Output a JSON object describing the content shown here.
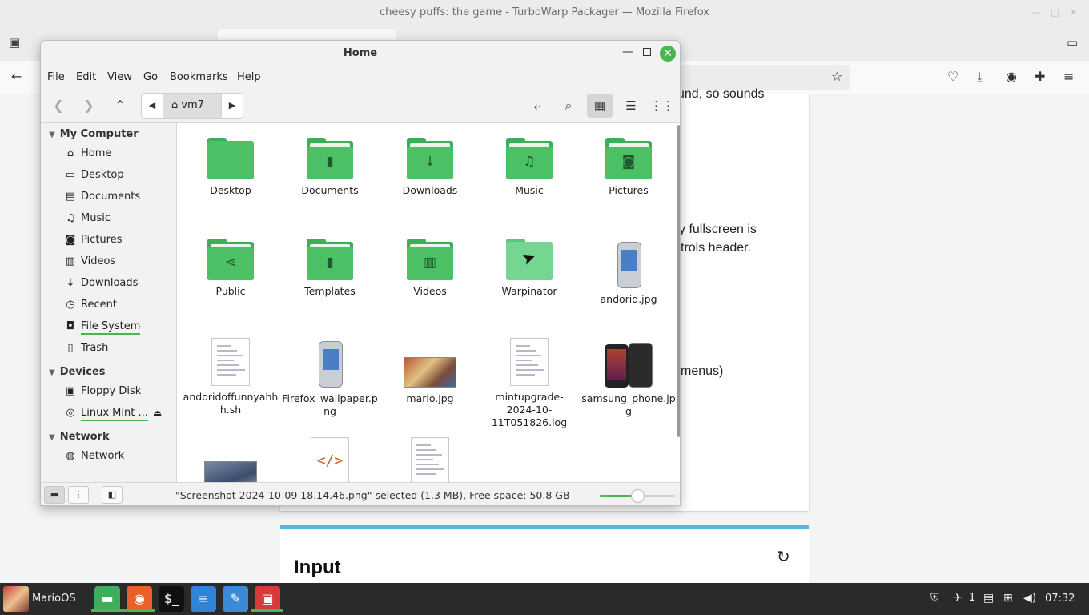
{
  "firefox": {
    "window_title": "cheesy puffs: the game - TurboWarp Packager — Mozilla Firefox",
    "page_snippets": [
      "und, so sounds",
      "y fullscreen is",
      "trols header.",
      "menus)"
    ],
    "input_heading": "Input"
  },
  "nemo": {
    "title": "Home",
    "menu": [
      "File",
      "Edit",
      "View",
      "Go",
      "Bookmarks",
      "Help"
    ],
    "path_crumb": "vm7",
    "sidebar": {
      "sections": [
        {
          "header": "My Computer",
          "items": [
            {
              "label": "Home",
              "icon": "home-icon",
              "glyph": "⌂"
            },
            {
              "label": "Desktop",
              "icon": "desktop-icon",
              "glyph": "▭"
            },
            {
              "label": "Documents",
              "icon": "documents-icon",
              "glyph": "▤"
            },
            {
              "label": "Music",
              "icon": "music-icon",
              "glyph": "♫"
            },
            {
              "label": "Pictures",
              "icon": "camera-icon",
              "glyph": "◙"
            },
            {
              "label": "Videos",
              "icon": "film-icon",
              "glyph": "▥"
            },
            {
              "label": "Downloads",
              "icon": "download-icon",
              "glyph": "↓"
            },
            {
              "label": "Recent",
              "icon": "clock-icon",
              "glyph": "◷"
            },
            {
              "label": "File System",
              "icon": "drive-icon",
              "glyph": "◘"
            },
            {
              "label": "Trash",
              "icon": "trash-icon",
              "glyph": "▯"
            }
          ]
        },
        {
          "header": "Devices",
          "items": [
            {
              "label": "Floppy Disk",
              "icon": "floppy-icon",
              "glyph": "▣"
            },
            {
              "label": "Linux Mint ...",
              "icon": "optical-disc-icon",
              "glyph": "◎"
            }
          ]
        },
        {
          "header": "Network",
          "items": [
            {
              "label": "Network",
              "icon": "network-icon",
              "glyph": "◍"
            }
          ]
        }
      ]
    },
    "files": [
      {
        "name": "Desktop",
        "kind": "folder",
        "glyph": ""
      },
      {
        "name": "Documents",
        "kind": "folder",
        "glyph": "▮"
      },
      {
        "name": "Downloads",
        "kind": "folder",
        "glyph": "↓"
      },
      {
        "name": "Music",
        "kind": "folder",
        "glyph": "♫"
      },
      {
        "name": "Pictures",
        "kind": "folder",
        "glyph": "◙"
      },
      {
        "name": "Public",
        "kind": "folder",
        "glyph": "⋖"
      },
      {
        "name": "Templates",
        "kind": "folder",
        "glyph": "▮"
      },
      {
        "name": "Videos",
        "kind": "folder",
        "glyph": "▥"
      },
      {
        "name": "Warpinator",
        "kind": "folder-light",
        "glyph": ""
      },
      {
        "name": "andorid.jpg",
        "kind": "phone",
        "glyph": ""
      },
      {
        "name": "andoridoffunnyahhh.sh",
        "kind": "doc",
        "glyph": ""
      },
      {
        "name": "Firefox_wallpaper.png",
        "kind": "phone",
        "glyph": ""
      },
      {
        "name": "mario.jpg",
        "kind": "photo",
        "glyph": ""
      },
      {
        "name": "mintupgrade-2024-10-11T051826.log",
        "kind": "doc",
        "glyph": ""
      },
      {
        "name": "samsung_phone.jpg",
        "kind": "samsung",
        "glyph": ""
      },
      {
        "name": "",
        "kind": "shot",
        "glyph": ""
      },
      {
        "name": "",
        "kind": "code",
        "glyph": ""
      },
      {
        "name": "",
        "kind": "doc",
        "glyph": ""
      }
    ],
    "status_text": "\"Screenshot 2024-10-09 18.14.46.png\" selected (1.3 MB), Free space: 50.8 GB",
    "zoom_level": 0.5
  },
  "taskbar": {
    "menu_label": "MarioOS",
    "tray_badge": "1",
    "clock": "07:32",
    "apps": [
      "files",
      "firefox",
      "terminal",
      "text-editor",
      "drawing",
      "turbowarp"
    ]
  }
}
